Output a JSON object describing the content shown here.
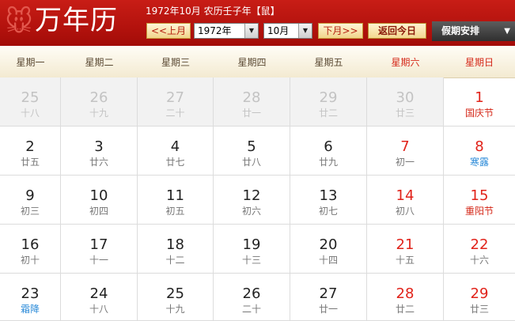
{
  "header": {
    "logo_mascot": "🐭",
    "logo_title": "万年历",
    "date_info": "1972年10月 农历壬子年【鼠】",
    "prev_label": "<<上月",
    "next_label": "下月>>",
    "today_label": "返回今日",
    "holiday_label": "假期安排",
    "holiday_arrow": "▼",
    "year_value": "1972年",
    "month_value": "10月",
    "dropdown_glyph": "▼"
  },
  "weekdays": [
    "星期一",
    "星期二",
    "星期三",
    "星期四",
    "星期五",
    "星期六",
    "星期日"
  ],
  "weeks": [
    [
      {
        "d": "25",
        "l": "十八"
      },
      {
        "d": "26",
        "l": "十九"
      },
      {
        "d": "27",
        "l": "二十"
      },
      {
        "d": "28",
        "l": "廿一"
      },
      {
        "d": "29",
        "l": "廿二"
      },
      {
        "d": "30",
        "l": "廿三"
      },
      {
        "d": "1",
        "l": "国庆节"
      }
    ],
    [
      {
        "d": "2",
        "l": "廿五"
      },
      {
        "d": "3",
        "l": "廿六"
      },
      {
        "d": "4",
        "l": "廿七"
      },
      {
        "d": "5",
        "l": "廿八"
      },
      {
        "d": "6",
        "l": "廿九"
      },
      {
        "d": "7",
        "l": "初一"
      },
      {
        "d": "8",
        "l": "寒露"
      }
    ],
    [
      {
        "d": "9",
        "l": "初三"
      },
      {
        "d": "10",
        "l": "初四"
      },
      {
        "d": "11",
        "l": "初五"
      },
      {
        "d": "12",
        "l": "初六"
      },
      {
        "d": "13",
        "l": "初七"
      },
      {
        "d": "14",
        "l": "初八"
      },
      {
        "d": "15",
        "l": "重阳节"
      }
    ],
    [
      {
        "d": "16",
        "l": "初十"
      },
      {
        "d": "17",
        "l": "十一"
      },
      {
        "d": "18",
        "l": "十二"
      },
      {
        "d": "19",
        "l": "十三"
      },
      {
        "d": "20",
        "l": "十四"
      },
      {
        "d": "21",
        "l": "十五"
      },
      {
        "d": "22",
        "l": "十六"
      }
    ],
    [
      {
        "d": "23",
        "l": "霜降"
      },
      {
        "d": "24",
        "l": "十八"
      },
      {
        "d": "25",
        "l": "十九"
      },
      {
        "d": "26",
        "l": "二十"
      },
      {
        "d": "27",
        "l": "廿一"
      },
      {
        "d": "28",
        "l": "廿二"
      },
      {
        "d": "29",
        "l": "廿三"
      }
    ]
  ],
  "colors": {
    "header_red": "#b3120d",
    "weekend_red": "#e1231a",
    "solar_term_blue": "#2a8ad8"
  }
}
